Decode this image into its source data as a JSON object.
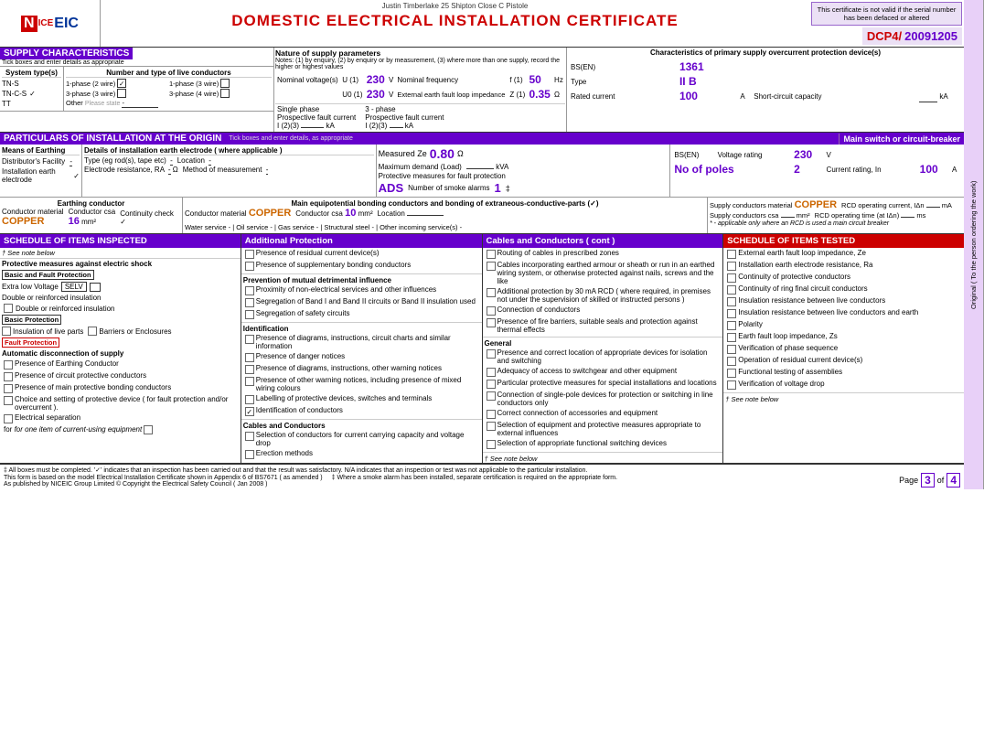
{
  "header": {
    "person_info": "Justin Timberlake  25 Shipton Close  C Pistole",
    "cert_invalid_text": "This certificate is not valid if the serial number has been defaced or altered",
    "dcp_label": "DCP4/",
    "cert_number": "20091205",
    "main_title": "DOMESTIC ELECTRICAL INSTALLATION CERTIFICATE"
  },
  "supply": {
    "section_title": "SUPPLY CHARACTERISTICS",
    "tick_note": "Tick boxes and enter details as appropriate",
    "system_types": {
      "label": "System type(s)",
      "items": [
        "TN-S",
        "TN-C-S",
        "TT"
      ],
      "checked": "TN-C-S"
    },
    "live_conductors": {
      "label": "Number and type of live conductors",
      "items": [
        {
          "phases": "1-phase (2 wire)",
          "checked": true
        },
        {
          "phases": "1-phase (3 wire)",
          "checked": false
        },
        {
          "phases": "3-phase (3 wire)",
          "checked": false
        },
        {
          "phases": "3-phase (4 wire)",
          "checked": false
        }
      ],
      "other": "Other"
    },
    "nature_title": "Nature of supply parameters",
    "nature_notes": "Notes: (1) by enquiry, (2) by enquiry or by measurement, (3) where more than one supply, record the higher or highest values",
    "nominal_voltage_label": "Nominal voltage(s)",
    "U1": "U (1)",
    "U1_val": "230",
    "U1_unit": "V",
    "U0": "U0 (1)",
    "U0_val": "230",
    "U0_unit": "V",
    "nominal_freq_label": "Nominal frequency",
    "freq_val": "50",
    "freq_unit": "Hz",
    "external_earth_label": "External earth fault loop impedance",
    "Ze_label": "Z (1)",
    "Ze_val": "0.35",
    "Ze_unit": "Ω",
    "single_phase_label": "Single phase",
    "prospective_label": "Prospective fault current",
    "I_2_3": "I (2)(3)",
    "single_phase_val": "",
    "single_phase_unit": "kA",
    "three_phase_label": "3 - phase",
    "three_phase_prospective": "Prospective fault current",
    "I_23_3phase": "I (2)(3)",
    "three_phase_val": "",
    "three_phase_unit": "kA"
  },
  "primary_supply": {
    "title": "Characteristics of primary supply overcurrent protection device(s)",
    "bsen_label": "BS(EN)",
    "bsen_val": "1361",
    "type_label": "Type",
    "type_val": "II B",
    "rated_label": "Rated current",
    "rated_val": "100",
    "rated_unit": "A",
    "short_circuit_label": "Short-circuit capacity",
    "short_circuit_val": "",
    "short_circuit_unit": "kA"
  },
  "particulars": {
    "section_title": "PARTICULARS OF INSTALLATION AT THE ORIGIN",
    "tick_note": "Tick boxes and enter details, as appropriate",
    "earthing": {
      "title": "Means of Earthing",
      "distributors_label": "Distributor's Facility",
      "distributors_val": "-",
      "installation_label": "Installation earth electrode",
      "installation_checked": true
    },
    "earth_electrode": {
      "title": "Details of installation earth electrode ( where applicable )",
      "type_label": "Type (eg rod(s), tape etc)",
      "type_val": "-",
      "location_label": "Location",
      "location_val": "-",
      "electrode_resistance_label": "Electrode resistance, RA",
      "electrode_resistance_val": "-",
      "electrode_resistance_unit": "Ω",
      "method_label": "Method of measurement",
      "method_val": "-"
    },
    "measured_ze": {
      "label": "Measured Ze",
      "val": "0.80",
      "unit": "Ω"
    },
    "max_demand_label": "Maximum demand (Load)",
    "max_demand_unit": "kVA",
    "protective_label": "Protective measures for fault protection",
    "ads_val": "ADS",
    "smoke_alarms_label": "Number of smoke alarms",
    "smoke_alarms_val": "1",
    "smoke_alarms_note": "‡",
    "main_switch": {
      "title": "Main switch or circuit-breaker",
      "bsen_label": "BS(EN)",
      "voltage_label": "Voltage rating",
      "voltage_val": "230",
      "voltage_unit": "V",
      "no_poles_label": "No of poles",
      "no_poles_val": "2",
      "current_rating_label": "Current rating, In",
      "current_rating_val": "100",
      "current_rating_unit": "A"
    }
  },
  "earthing_conductor": {
    "title": "Earthing conductor",
    "conductor_material_label": "Conductor material",
    "conductor_material_val": "COPPER",
    "conductor_csa_label": "Conductor csa",
    "conductor_csa_val": "16",
    "conductor_csa_unit": "mm²",
    "continuity_check_label": "Continuity check",
    "continuity_checked": true
  },
  "bonding": {
    "title": "Main equipotential bonding conductors and bonding of extraneous-conductive-parts (✓)",
    "conductor_material_label": "Conductor material",
    "conductor_material_val": "COPPER",
    "conductor_csa_label": "Conductor csa",
    "conductor_csa_val": "10",
    "conductor_csa_unit": "mm²",
    "location_label": "Location",
    "location_val": "",
    "water_service_label": "Water service",
    "water_val": "-",
    "oil_service_label": "Oil service",
    "oil_val": "-",
    "gas_service_label": "Gas service",
    "gas_val": "-",
    "structural_steel_label": "Structural steel",
    "structural_val": "-",
    "other_incoming_label": "Other incoming service(s)",
    "other_val": "-"
  },
  "rcd": {
    "supply_conductors_material_label": "Supply conductors material",
    "supply_material_val": "COPPER",
    "rcd_operating_current_label": "RCD operating current, IΔn",
    "rcd_current_unit": "mA",
    "supply_conductors_csa_label": "Supply conductors csa",
    "supply_csa_unit": "mm²",
    "rcd_operating_time_label": "RCD operating time (at IΔn)",
    "rcd_time_unit": "ms",
    "rcd_note": "* - applicable only where an RCD is used a main circuit breaker"
  },
  "schedule_inspected": {
    "title": "SCHEDULE OF ITEMS INSPECTED",
    "note": "† See note below",
    "protective_measures_title": "Protective measures against electric shock",
    "basic_fault_protection_label": "Basic and Fault Protection",
    "extra_low_voltage_label": "Extra low Voltage",
    "selv_label": "SELV",
    "double_insulation_label": "Double or reinforced insulation",
    "double_insulation_item": "Double or reinforced insulation",
    "basic_protection_label": "Basic Protection",
    "insulation_live_label": "Insulation of live parts",
    "barriers_enclosures_label": "Barriers or Enclosures",
    "fault_protection_label": "Fault Protection",
    "auto_disconnection_label": "Automatic disconnection of supply",
    "items": [
      "Presence of Earthing Conductor",
      "Presence of circuit protective conductors",
      "Presence of main protective bonding conductors",
      "Choice and setting of protective device ( for fault protection and/or overcurrent ).",
      "Electrical separation"
    ],
    "for_one_label": "for one item of current-using equipment"
  },
  "additional_protection": {
    "title": "Additional Protection",
    "items": [
      "Presence of residual current device(s)",
      "Presence of supplementary bonding conductors"
    ],
    "prevention_title": "Prevention of mutual detrimental influence",
    "prevention_items": [
      "Proximity of non-electrical services and other influences",
      "Segregation of Band I and Band II circuits or Band II insulation used",
      "Segregation of safety circuits"
    ],
    "identification_title": "Identification",
    "identification_items": [
      "Presence of diagrams, instructions, circuit charts and similar information",
      "Presence of danger notices",
      "Presence of diagrams, instructions, other warning notices",
      "Presence of other warning notices, including presence of mixed wiring colours",
      "Labelling of protective devices, switches and terminals",
      "Identification of conductors"
    ],
    "cables_title": "Cables and Conductors",
    "cables_items": [
      "Selection of conductors for current carrying capacity and voltage drop",
      "Erection methods"
    ]
  },
  "cables_cont": {
    "title": "Cables and Conductors ( cont )",
    "items": [
      "Routing of cables in prescribed zones",
      "Cables incorporating earthed armour or sheath or run in an earthed wiring system, or otherwise protected against nails, screws and the like",
      "Additional protection by 30 mA RCD ( where required, in premises not under the supervision of skilled or instructed persons )",
      "Connection of conductors",
      "Presence of fire barriers, suitable seals and protection against thermal effects"
    ],
    "general_title": "General",
    "general_items": [
      "Presence and correct location of appropriate devices for isolation and switching",
      "Adequacy of access to switchgear and other equipment",
      "Particular protective measures for special installations and locations",
      "Connection of single-pole devices for protection or switching in line conductors only",
      "Correct connection of accessories and equipment",
      "Selection of equipment and protective measures appropriate to external influences",
      "Selection of appropriate functional switching devices"
    ],
    "see_note": "† See note below"
  },
  "schedule_tested": {
    "title": "SCHEDULE OF ITEMS TESTED",
    "items": [
      "External earth fault loop impedance, Ze",
      "Installation earth electrode resistance, Ra",
      "Continuity of protective conductors",
      "Continuity of ring final circuit conductors",
      "Insulation resistance between live conductors",
      "Insulation resistance between live conductors and earth",
      "Polarity",
      "Earth fault loop impedance, Zs",
      "Verification of phase sequence",
      "Operation of residual current device(s)",
      "Functional testing of assemblies",
      "Verification of voltage drop"
    ],
    "see_note": "† See note below"
  },
  "side_label": {
    "text": "Original  ( To the person ordering the work)"
  },
  "footer": {
    "note1": "‡ All boxes must be completed. '✓' indicates that an inspection has been carried out and that the result was satisfactory. N/A indicates that an inspection or test was not applicable to the particular installation.",
    "note2": "This form is based on the model Electrical Installation Certificate shown in Appendix 6 of BS7671 ( as amended )",
    "note3": "‡ Where a smoke alarm has been installed, separate certification is required on the appropriate form.",
    "note4": "As published by NICEIC Group Limited © Copyright the Electrical Safety Council ( Jan 2008 )",
    "page_label": "Page",
    "page_of": "of",
    "page_num": "3",
    "page_total": "4"
  }
}
